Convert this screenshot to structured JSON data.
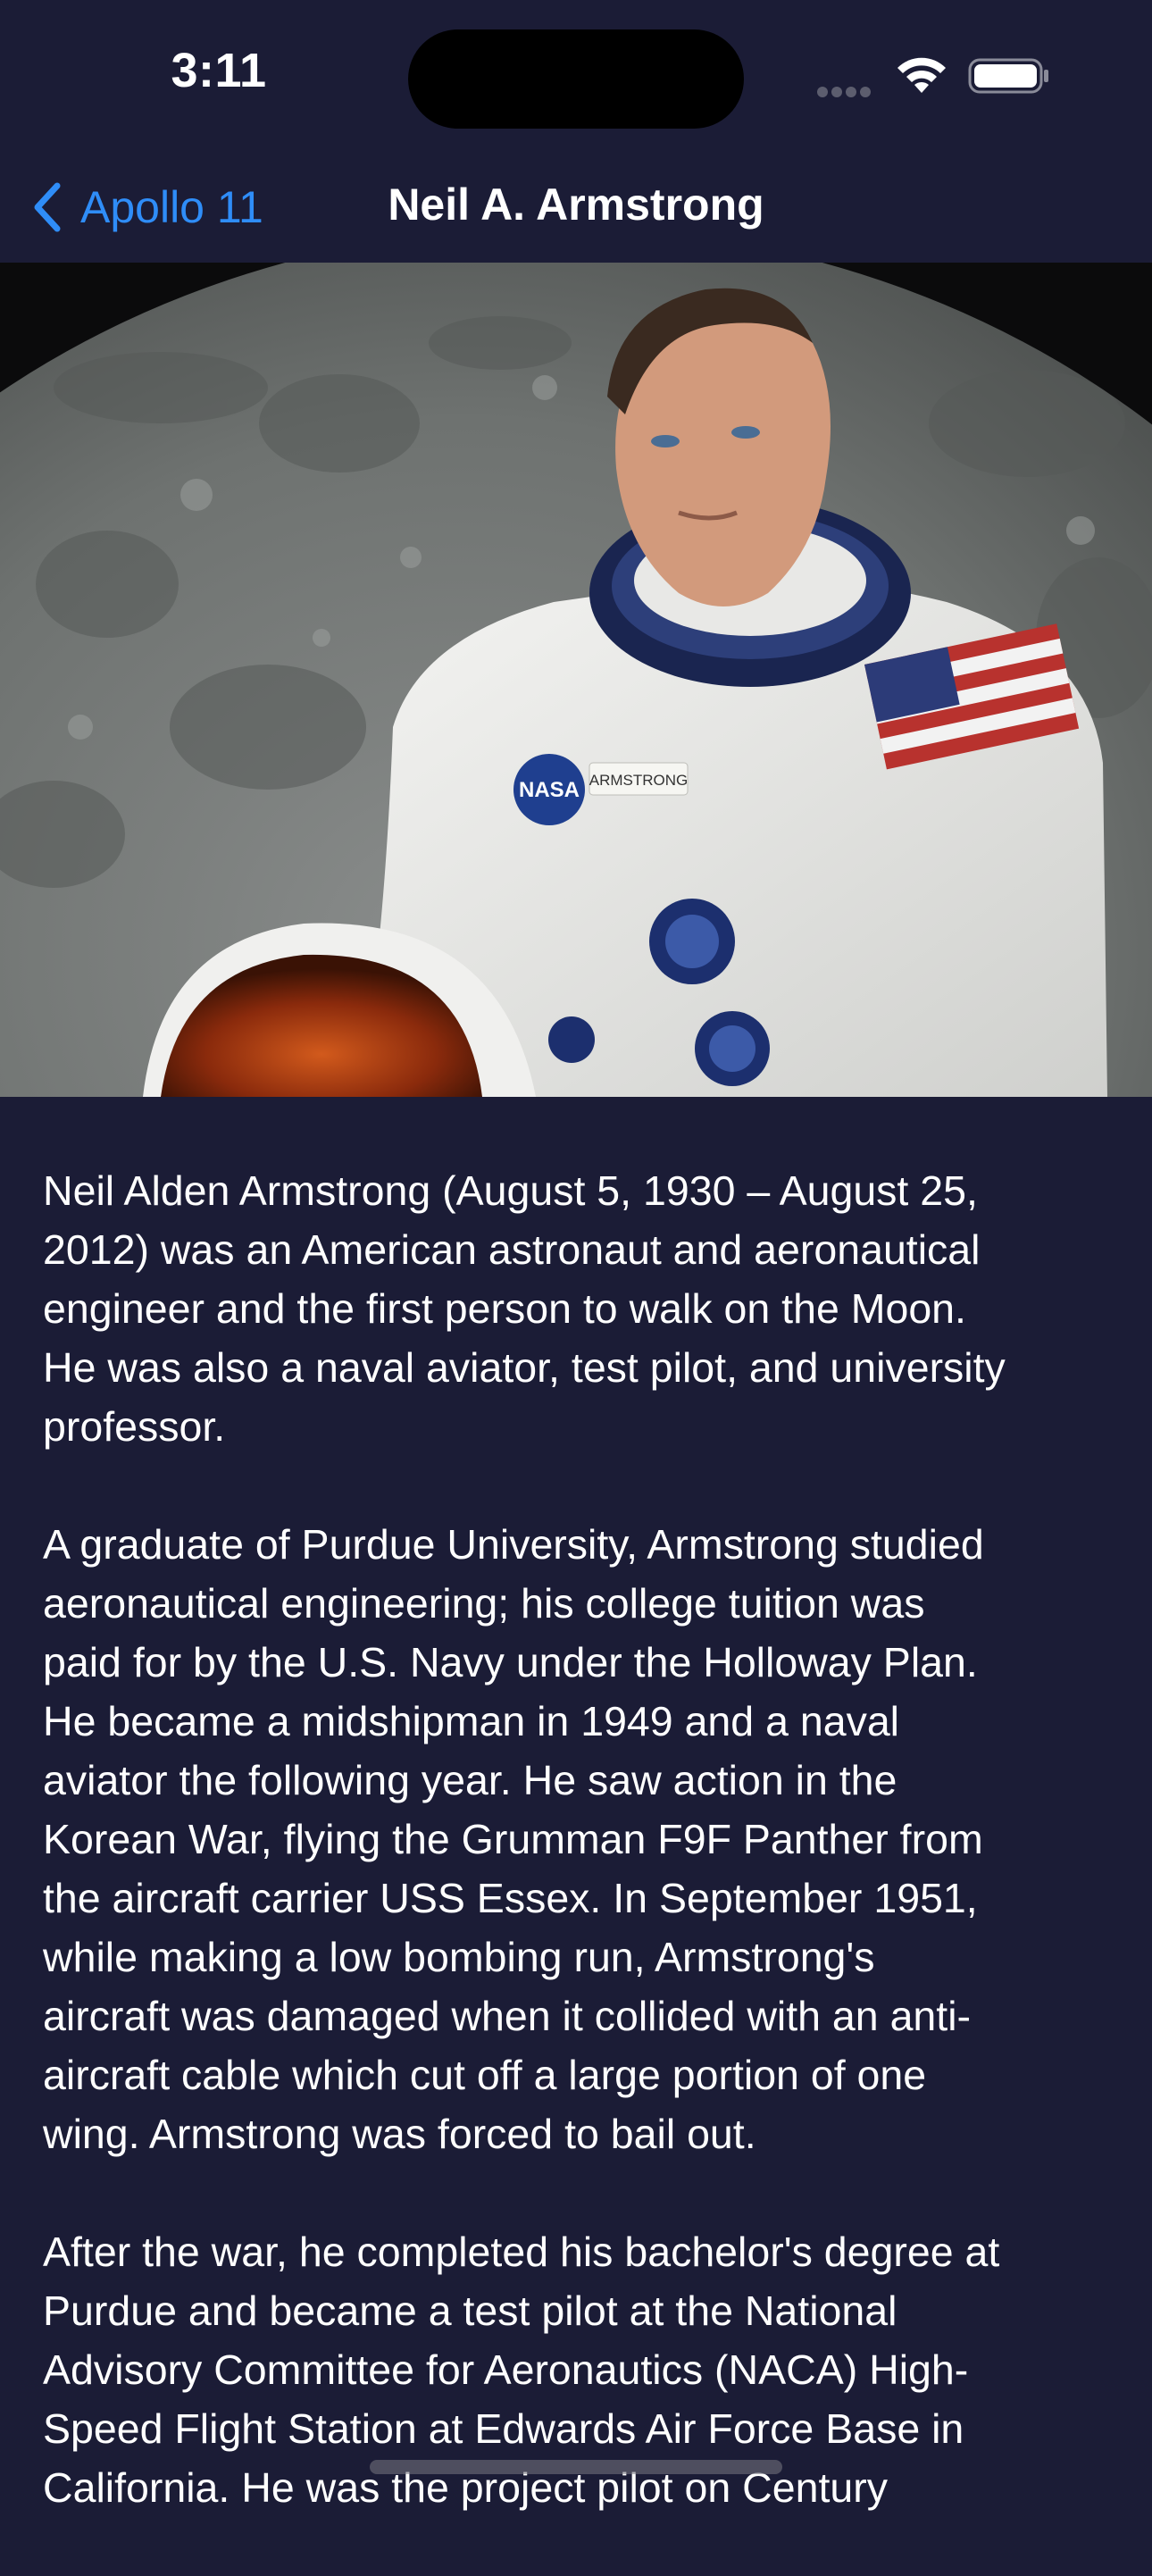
{
  "status_bar": {
    "time": "3:11"
  },
  "nav": {
    "back_label": "Apollo 11",
    "title": "Neil A. Armstrong"
  },
  "hero_image": {
    "subject": "Portrait of astronaut in white spacesuit in front of the Moon",
    "name_tag": "ARMSTRONG",
    "patch": "NASA"
  },
  "bio": {
    "paragraphs": [
      "Neil Alden Armstrong (August 5, 1930 – August 25,\n2012) was an American astronaut and aeronautical\nengineer and the first person to walk on the Moon.\nHe was also a naval aviator, test pilot, and university\nprofessor.",
      "A graduate of Purdue University, Armstrong studied\naeronautical engineering; his college tuition was\npaid for by the U.S. Navy under the Holloway Plan.\nHe became a midshipman in 1949 and a naval\naviator the following year. He saw action in the\nKorean War, flying the Grumman F9F Panther from\nthe aircraft carrier USS Essex. In September 1951,\nwhile making a low bombing run, Armstrong's\naircraft was damaged when it collided with an anti-\naircraft cable which cut off a large portion of one\nwing. Armstrong was forced to bail out.",
      "After the war, he completed his bachelor's degree at\nPurdue and became a test pilot at the National\nAdvisory Committee for Aeronautics (NACA) High-\nSpeed Flight Station at Edwards Air Force Base in\nCalifornia. He was the project pilot on Century"
    ]
  },
  "colors": {
    "background": "#1b1c36",
    "accent": "#2f8df8",
    "text": "#ffffff"
  }
}
